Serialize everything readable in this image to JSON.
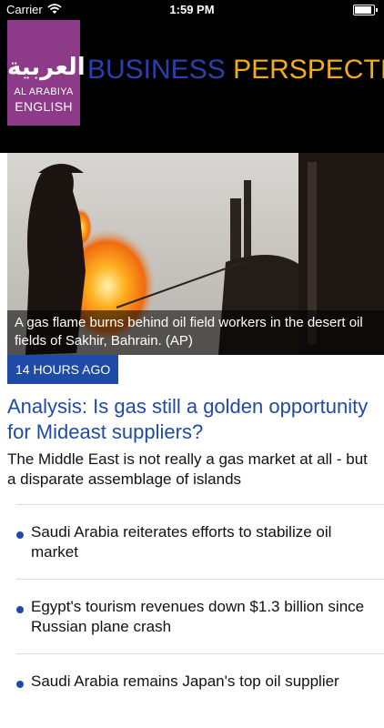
{
  "status_bar": {
    "carrier": "Carrier",
    "time": "1:59 PM",
    "battery_level": 1.0
  },
  "header": {
    "logo": {
      "arabic_text": "العربية",
      "line1": "AL ARABIYA",
      "line2": "ENGLISH"
    },
    "title_word1": "BUSINESS",
    "title_word2": "PERSPECTIVES",
    "colors": {
      "title_blue": "#2a41ad",
      "title_orange": "#f2ac1b",
      "logo_purple": "#8d3a88"
    }
  },
  "article": {
    "image_caption": "A gas flame burns behind oil field workers in the desert oil fields of Sakhir, Bahrain. (AP)",
    "time_ago": "14 HOURS AGO",
    "headline": "Analysis: Is gas still a golden opportunity for Mideast suppliers?",
    "summary": "The Middle East is not really a gas market at all - but a disparate assemblage of islands"
  },
  "related": [
    {
      "title": "Saudi Arabia reiterates efforts to stabilize oil market"
    },
    {
      "title": "Egypt's tourism revenues down $1.3 billion since Russian plane crash"
    },
    {
      "title": "Saudi Arabia remains Japan's top oil supplier"
    }
  ],
  "accent_color": "#1f4aa8"
}
